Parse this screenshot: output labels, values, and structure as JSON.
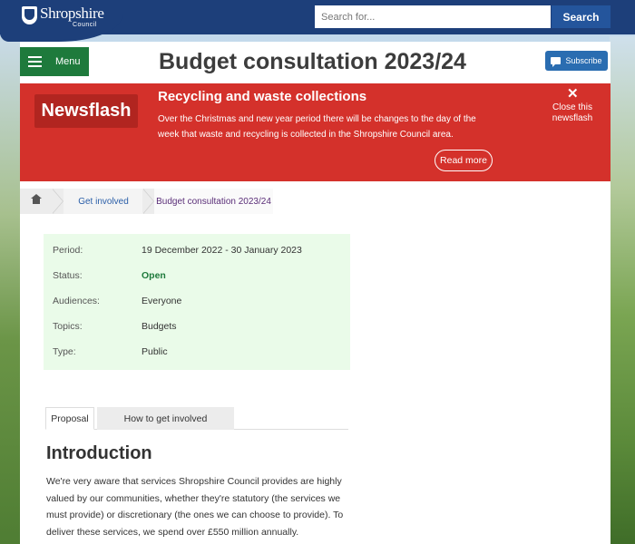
{
  "header": {
    "logo_text": "Shropshire",
    "logo_subtext": "Council",
    "search_placeholder": "Search for...",
    "search_button": "Search"
  },
  "page": {
    "menu_label": "Menu",
    "title": "Budget consultation 2023/24",
    "subscribe_label": "Subscribe"
  },
  "newsflash": {
    "badge": "Newsflash",
    "heading": "Recycling and waste collections",
    "body": "Over the Christmas and new year period there will be changes to the day of the week that waste and recycling is collected in the Shropshire Council area.",
    "close_label": "Close this newsflash",
    "read_more": "Read more"
  },
  "breadcrumb": {
    "items": [
      "Get involved",
      "Budget consultation 2023/24"
    ]
  },
  "consultation": {
    "rows": [
      {
        "label": "Period:",
        "value": "19 December 2022 - 30 January 2023"
      },
      {
        "label": "Status:",
        "value": "Open"
      },
      {
        "label": "Audiences:",
        "value": "Everyone"
      },
      {
        "label": "Topics:",
        "value": "Budgets"
      },
      {
        "label": "Type:",
        "value": "Public"
      }
    ]
  },
  "tabs": [
    "Proposal",
    "How to get involved"
  ],
  "content": {
    "heading": "Introduction",
    "body": "We're very aware that services Shropshire Council provides are highly valued by our communities, whether they're statutory (the services we must provide) or discretionary (the ones we can choose to provide). To deliver these services, we spend over £550 million annually."
  },
  "colors": {
    "header_blue": "#1d3f7a",
    "menu_green": "#1e7a3c",
    "newsflash_red": "#d4312b",
    "info_bg": "#eafbe9"
  }
}
